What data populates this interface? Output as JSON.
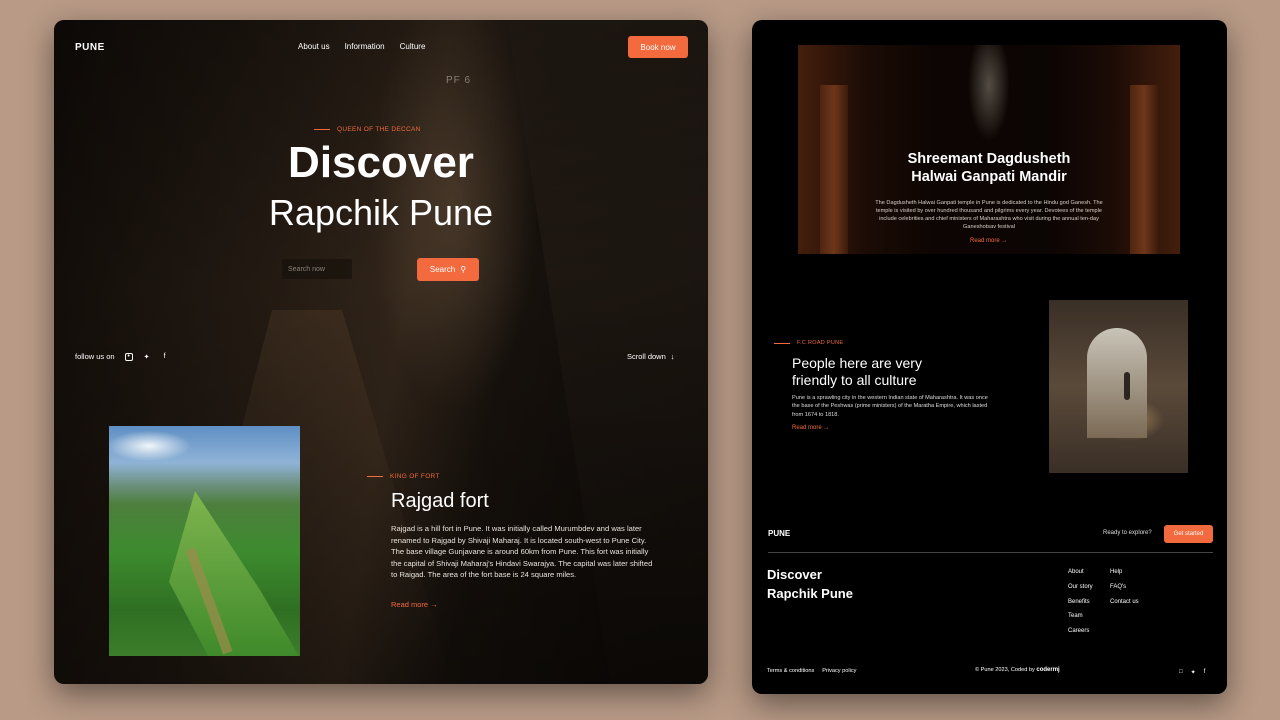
{
  "left": {
    "logo": "PUNE",
    "nav": [
      "About us",
      "Information",
      "Culture"
    ],
    "book_label": "Book now",
    "platform_sign": "PF 6",
    "hero": {
      "eyebrow": "QUEEN OF THE DECCAN",
      "title": "Discover",
      "subtitle": "Rapchik Pune",
      "search_placeholder": "Search now",
      "search_label": "Search"
    },
    "follow_label": "follow us on",
    "scroll_label": "Scroll down",
    "fort": {
      "eyebrow": "KING OF FORT",
      "title": "Rajgad fort",
      "text": "Rajgad is a hill fort in Pune. It was initially called Murumbdev and was later renamed to Rajgad by Shivaji Maharaj. It is located south-west to Pune City. The base village Gunjavane is around 60km from Pune. This fort was initially the capital of Shivaji Maharaj's Hindavi Swarajya. The capital was later shifted to Raigad. The area of the fort base is 24 square miles.",
      "read_more": "Read more"
    }
  },
  "right": {
    "temple": {
      "title_line1": "Shreemant Dagdusheth",
      "title_line2": "Halwai Ganpati Mandir",
      "text": "The Dagdusheth Halwai Ganpati temple in Pune is dedicated to the Hindu god Ganesh. The temple is visited by over hundred thousand and pilgrims every year. Devotees of the temple include celebrities and chief ministers of Maharashtra who visit during the annual ten-day Ganeshotsav festival",
      "read_more": "Read more"
    },
    "fc": {
      "eyebrow": "F.C ROAD PUNE",
      "title_line1": "People here are very",
      "title_line2": "friendly to all culture",
      "text": "Pune is a sprawling city in the western Indian state of Maharashtra. It was once the base of the Peshwas (prime ministers) of the Maratha Empire, which lasted from 1674 to 1818.",
      "read_more": "Read more"
    },
    "footer": {
      "logo": "PUNE",
      "ready": "Ready to explore?",
      "get_started": "Get started",
      "title_line1": "Discover",
      "title_line2": "Rapchik Pune",
      "col1": [
        "About",
        "Our story",
        "Benefits",
        "Team",
        "Careers"
      ],
      "col2": [
        "Help",
        "FAQ's",
        "Contact us"
      ],
      "terms": "Terms & conditions",
      "privacy": "Privacy policy",
      "copyright": "© Pune 2023, Coded by",
      "coder": "codermj"
    }
  },
  "colors": {
    "accent": "#f26a3d",
    "background": "#b89a86",
    "panel": "#000000"
  }
}
